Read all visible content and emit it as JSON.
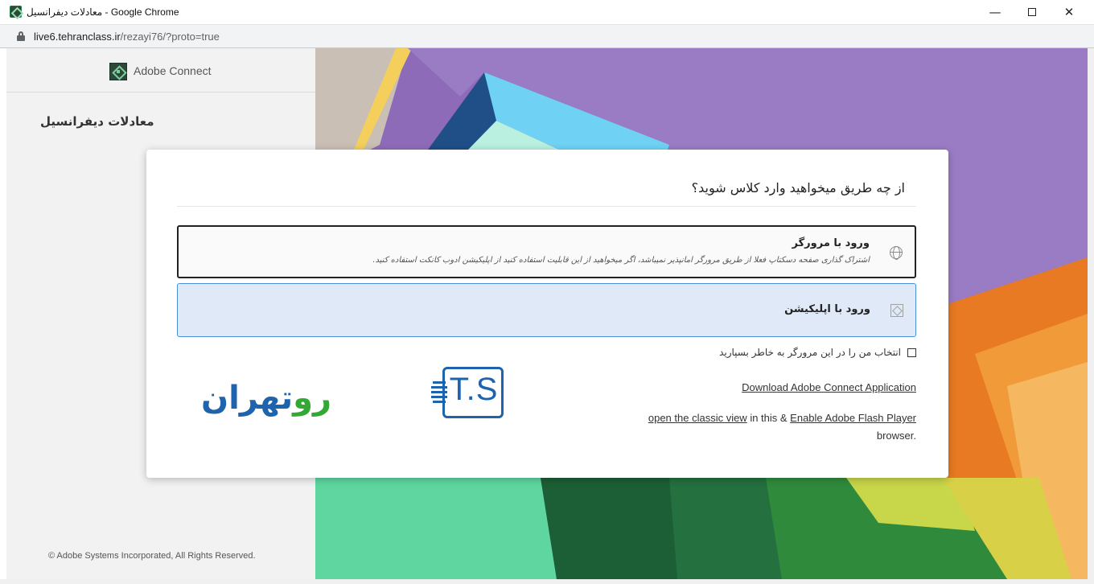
{
  "window": {
    "title": "معادلات دیفرانسیل - Google Chrome",
    "minimize": "—",
    "close": "✕"
  },
  "address_bar": {
    "host": "live6.tehranclass.ir",
    "path": "/rezayi76/?proto=true"
  },
  "sidebar": {
    "app_name": "Adobe Connect",
    "room_title": "معادلات دیفرانسیل",
    "copyright": "© Adobe Systems Incorporated, All Rights Reserved."
  },
  "modal": {
    "title": "از چه طریق میخواهید وارد کلاس شوید؟",
    "options": [
      {
        "label": "ورود با مرورگر",
        "description": "اشتراک گذاری صفحه دسکتاپ فعلا از طریق مرورگر امانپذیر نمیباشد، اگر میخواهید از این قابلیت استفاده کنید از اپلیکیشن ادوب کانکت استفاده کنید.",
        "icon": "globe-icon",
        "selected": false
      },
      {
        "label": "ورود با اپلیکیشن",
        "icon": "app-icon",
        "selected": true
      }
    ],
    "remember": {
      "label": "انتخاب من را در این مرورگر به خاطر بسپارید",
      "checked": false
    },
    "download_link": "Download Adobe Connect Application",
    "classic_view_link": "open the classic view",
    "classic_mid": " in this & ",
    "flash_link": "Enable Adobe Flash Player",
    "classic_end": "browser."
  },
  "brand": {
    "text_green": "رو",
    "text_blue": "تهران",
    "mark": "T.S"
  },
  "colors": {
    "modal_selected_bg": "#dfe9f8",
    "modal_selected_border": "#4a90d9",
    "brand_blue": "#1d63ad",
    "brand_green": "#34a835"
  }
}
